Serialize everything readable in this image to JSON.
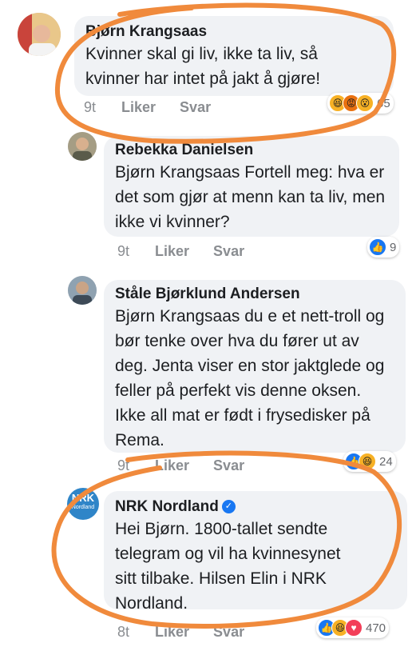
{
  "comments": [
    {
      "author": "Bjørn Krangsaas",
      "text": "Kvinner skal gi liv, ikke ta liv, så kvinner har intet på jakt å gjøre!",
      "time": "9t",
      "like_label": "Liker",
      "reply_label": "Svar",
      "reaction_count": "65",
      "reactions": [
        "haha-icon",
        "angry-icon",
        "wow-icon"
      ]
    },
    {
      "author": "Rebekka Danielsen",
      "text": "Bjørn Krangsaas Fortell meg: hva er det som gjør at menn kan ta liv, men ikke vi kvinner?",
      "time": "9t",
      "like_label": "Liker",
      "reply_label": "Svar",
      "reaction_count": "9",
      "reactions": [
        "like-icon"
      ]
    },
    {
      "author": "Ståle Bjørklund Andersen",
      "text": "Bjørn Krangsaas du e et nett-troll og bør tenke over hva du fører ut av deg. Jenta viser en stor jaktglede og feller på perfekt vis denne oksen. Ikke all mat er født i frysedisker på Rema.",
      "time": "9t",
      "like_label": "Liker",
      "reply_label": "Svar",
      "reaction_count": "24",
      "reactions": [
        "like-icon",
        "haha-icon"
      ]
    },
    {
      "author": "NRK Nordland",
      "text": "Hei Bjørn. 1800-tallet sendte telegram og vil ha kvinnesynet sitt tilbake. Hilsen Elin i NRK Nordland.",
      "time": "8t",
      "like_label": "Liker",
      "reply_label": "Svar",
      "reaction_count": "470",
      "reactions": [
        "like-icon",
        "haha-icon",
        "love-icon"
      ],
      "avatar_logo": "NRK",
      "avatar_sub": "Nordland"
    }
  ],
  "colors": {
    "bubble": "#f0f2f5",
    "annotation": "#f08a3c",
    "like": "#1877f2"
  }
}
